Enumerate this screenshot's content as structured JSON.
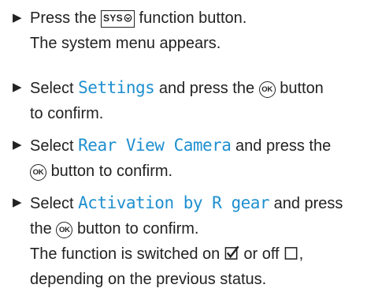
{
  "steps": [
    {
      "line1": {
        "t1": "Press the",
        "button": "SYS",
        "t2": "function button."
      },
      "line2": "The system menu appears."
    },
    {
      "line1": {
        "t1": "Select",
        "item": "Settings",
        "t2": "and press the",
        "button": "OK",
        "t3": "button"
      },
      "line2": "to confirm."
    },
    {
      "line1": {
        "t1": "Select",
        "item": "Rear View Camera",
        "t2": "and press the"
      },
      "line2": {
        "button": "OK",
        "t1": "button to confirm."
      }
    },
    {
      "line1": {
        "t1": "Select",
        "item": "Activation by R gear",
        "t2": "and press"
      },
      "line2": {
        "t1": "the",
        "button": "OK",
        "t2": "button to confirm."
      },
      "line3": {
        "t1": "The function is switched on",
        "t2": "or off",
        "t3": ","
      },
      "line4": "depending on the previous status."
    }
  ]
}
